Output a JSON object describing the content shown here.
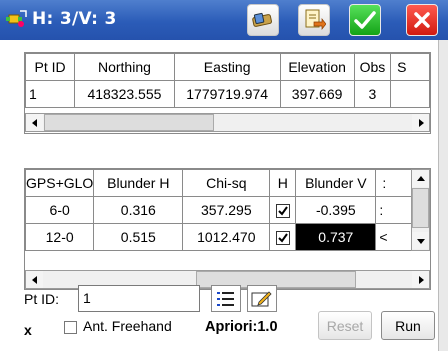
{
  "title": "H: 3/V: 3",
  "point_table": {
    "columns": [
      "Pt ID",
      "Northing",
      "Easting",
      "Elevation",
      "Obs",
      "S"
    ],
    "rows": [
      [
        "1",
        "418323.555",
        "1779719.974",
        "397.669",
        "3",
        ""
      ]
    ]
  },
  "obs_table": {
    "columns": [
      "GPS+GLO",
      "Blunder H",
      "Chi-sq",
      "H",
      "Blunder V",
      ":"
    ],
    "rows": [
      {
        "sat": "6-0",
        "blunder_h": "0.316",
        "chi_sq": "357.295",
        "h_checked": true,
        "blunder_v": "-0.395",
        "extra": ":"
      },
      {
        "sat": "12-0",
        "blunder_h": "0.515",
        "chi_sq": "1012.470",
        "h_checked": true,
        "blunder_v": "0.737",
        "extra": "<"
      }
    ]
  },
  "footer": {
    "pt_id_label": "Pt ID:",
    "pt_id_value": "1",
    "x_label": "x",
    "ant_freehand_label": "Ant. Freehand",
    "ant_freehand_checked": false,
    "apriori_label": "Apriori:1.0",
    "reset_label": "Reset",
    "run_label": "Run"
  },
  "colors": {
    "titlebar": "#2b5cb8",
    "ok_green": "#14a317",
    "close_red": "#d11a10",
    "selected_cell": "#000000"
  },
  "icons": [
    "app-satellite-icon",
    "eraser-icon",
    "export-icon",
    "ok-check-icon",
    "close-x-icon",
    "list-icon",
    "edit-icon"
  ]
}
